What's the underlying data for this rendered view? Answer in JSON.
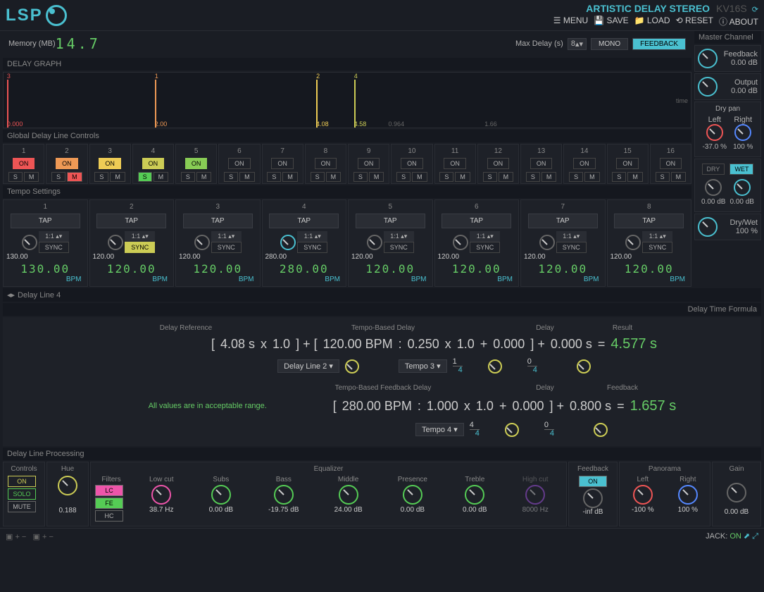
{
  "header": {
    "logo_text": "LSP",
    "plugin_title": "ARTISTIC DELAY STEREO",
    "plugin_version": "KV16S",
    "menu": {
      "menu": "MENU",
      "save": "SAVE",
      "load": "LOAD",
      "reset": "RESET",
      "about": "ABOUT"
    }
  },
  "memory": {
    "label": "Memory (MB)",
    "value": "14.7"
  },
  "max_delay": {
    "label": "Max Delay (s)",
    "value": "8",
    "mono": "MONO",
    "feedback": "FEEDBACK"
  },
  "master": {
    "title": "Master Channel",
    "feedback": {
      "label": "Feedback",
      "value": "0.00 dB"
    },
    "output": {
      "label": "Output",
      "value": "0.00 dB"
    },
    "dry_pan": {
      "title": "Dry pan",
      "left": "Left",
      "right": "Right",
      "left_val": "-37.0 %",
      "right_val": "100 %"
    },
    "dry": {
      "btn": "DRY",
      "value": "0.00 dB"
    },
    "wet": {
      "btn": "WET",
      "value": "0.00 dB"
    },
    "drywet": {
      "label": "Dry/Wet",
      "value": "100 %"
    }
  },
  "sections": {
    "delay_graph": "DELAY GRAPH",
    "global": "Global Delay Line Controls",
    "tempo": "Tempo Settings",
    "delay_line": "Delay Line 4",
    "formula": "Delay Time Formula",
    "processing": "Delay Line Processing"
  },
  "graph": {
    "time_label": "time",
    "markers": [
      {
        "pos": 0.5,
        "label": "0.000",
        "top": "3",
        "color": "#e55"
      },
      {
        "pos": 22,
        "label": "2.00",
        "top": "1",
        "color": "#e95"
      },
      {
        "pos": 45.5,
        "label": "4.08",
        "top": "2",
        "color": "#ec5"
      },
      {
        "pos": 51,
        "label": "4.58",
        "top": "4",
        "color": "#cc5"
      },
      {
        "pos": 56,
        "label": "0.964",
        "color": "#555"
      },
      {
        "pos": 70,
        "label": "1.66",
        "color": "#555"
      }
    ]
  },
  "global_cols": [
    {
      "n": "1",
      "on": "ON",
      "color": "#e55",
      "active": true
    },
    {
      "n": "2",
      "on": "ON",
      "color": "#e95",
      "active": true,
      "m": true
    },
    {
      "n": "3",
      "on": "ON",
      "color": "#ec5",
      "active": true
    },
    {
      "n": "4",
      "on": "ON",
      "color": "#cc5",
      "active": true,
      "s": true
    },
    {
      "n": "5",
      "on": "ON",
      "color": "#8c5",
      "active": true
    },
    {
      "n": "6",
      "on": "ON"
    },
    {
      "n": "7",
      "on": "ON"
    },
    {
      "n": "8",
      "on": "ON"
    },
    {
      "n": "9",
      "on": "ON"
    },
    {
      "n": "10",
      "on": "ON"
    },
    {
      "n": "11",
      "on": "ON"
    },
    {
      "n": "12",
      "on": "ON"
    },
    {
      "n": "13",
      "on": "ON"
    },
    {
      "n": "14",
      "on": "ON"
    },
    {
      "n": "15",
      "on": "ON"
    },
    {
      "n": "16",
      "on": "ON"
    }
  ],
  "tempo_cols": [
    {
      "n": "1",
      "tap": "TAP",
      "ratio": "1:1",
      "sync": "SYNC",
      "val": "130.00",
      "big": "130.00",
      "bpm": "BPM"
    },
    {
      "n": "2",
      "tap": "TAP",
      "ratio": "1:1",
      "sync": "SYNC",
      "val": "120.00",
      "big": "120.00",
      "bpm": "BPM",
      "sync_active": true
    },
    {
      "n": "3",
      "tap": "TAP",
      "ratio": "1:1",
      "sync": "SYNC",
      "val": "120.00",
      "big": "120.00",
      "bpm": "BPM"
    },
    {
      "n": "4",
      "tap": "TAP",
      "ratio": "1:1",
      "sync": "SYNC",
      "val": "280.00",
      "big": "280.00",
      "bpm": "BPM",
      "knob": "cyan"
    },
    {
      "n": "5",
      "tap": "TAP",
      "ratio": "1:1",
      "sync": "SYNC",
      "val": "120.00",
      "big": "120.00",
      "bpm": "BPM"
    },
    {
      "n": "6",
      "tap": "TAP",
      "ratio": "1:1",
      "sync": "SYNC",
      "val": "120.00",
      "big": "120.00",
      "bpm": "BPM"
    },
    {
      "n": "7",
      "tap": "TAP",
      "ratio": "1:1",
      "sync": "SYNC",
      "val": "120.00",
      "big": "120.00",
      "bpm": "BPM"
    },
    {
      "n": "8",
      "tap": "TAP",
      "ratio": "1:1",
      "sync": "SYNC",
      "val": "120.00",
      "big": "120.00",
      "bpm": "BPM"
    }
  ],
  "formula_delay": {
    "ref_title": "Delay Reference",
    "tempo_title": "Tempo-Based Delay",
    "delay_title": "Delay",
    "result_title": "Result",
    "ref_val": "4.08 s",
    "ref_mul": "1.0",
    "ref_select": "Delay Line 2",
    "bpm": "120.00 BPM",
    "bpm_select": "Tempo 3",
    "beat": "0.250",
    "frac_n": "1",
    "frac_d": "4",
    "mul": "1.0",
    "add": "0.000",
    "add_n": "0",
    "add_d": "4",
    "delay": "0.000 s",
    "result": "4.577 s"
  },
  "formula_fb": {
    "title": "Tempo-Based Feedback Delay",
    "delay_title": "Delay",
    "result_title": "Feedback",
    "note": "All values are in acceptable range.",
    "bpm": "280.00 BPM",
    "bpm_select": "Tempo 4",
    "beat": "1.000",
    "frac_n": "4",
    "frac_d": "4",
    "mul": "1.0",
    "add": "0.000",
    "add_n": "0",
    "add_d": "4",
    "delay": "0.800 s",
    "result": "1.657 s"
  },
  "processing": {
    "controls": {
      "title": "Controls",
      "on": "ON",
      "solo": "SOLO",
      "mute": "MUTE"
    },
    "hue": {
      "title": "Hue",
      "value": "0.188"
    },
    "eq": {
      "title": "Equalizer",
      "filters": {
        "label": "Filters",
        "lc": "LC",
        "fe": "FE",
        "hc": "HC"
      },
      "bands": [
        {
          "name": "Low cut",
          "val": "38.7 Hz",
          "color": "pink"
        },
        {
          "name": "Subs",
          "val": "0.00 dB",
          "color": "green"
        },
        {
          "name": "Bass",
          "val": "-19.75 dB",
          "color": "green"
        },
        {
          "name": "Middle",
          "val": "24.00 dB",
          "color": "green"
        },
        {
          "name": "Presence",
          "val": "0.00 dB",
          "color": "green"
        },
        {
          "name": "Treble",
          "val": "0.00 dB",
          "color": "green"
        },
        {
          "name": "High cut",
          "val": "8000 Hz",
          "color": "purple",
          "dim": true
        }
      ]
    },
    "feedback": {
      "title": "Feedback",
      "on": "ON",
      "value": "-inf dB"
    },
    "panorama": {
      "title": "Panorama",
      "left": "Left",
      "left_val": "-100 %",
      "right": "Right",
      "right_val": "100 %"
    },
    "gain": {
      "title": "Gain",
      "value": "0.00 dB"
    }
  },
  "footer": {
    "jack": "JACK:",
    "on": "ON"
  }
}
